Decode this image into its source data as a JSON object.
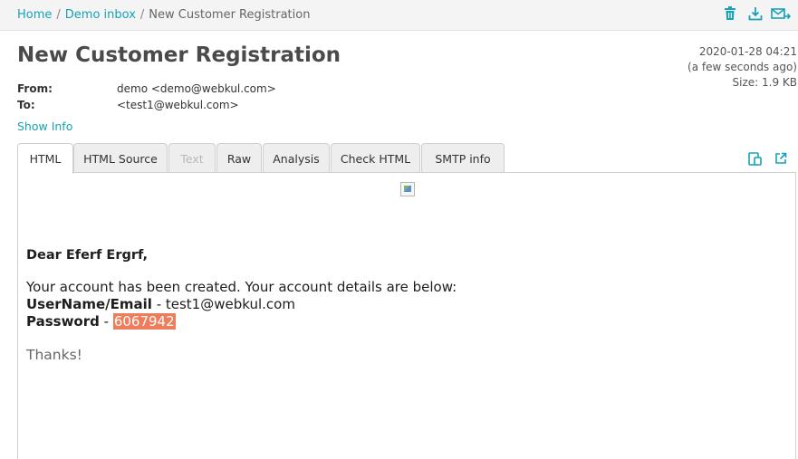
{
  "breadcrumb": {
    "home": "Home",
    "inbox": "Demo inbox",
    "current": "New Customer Registration",
    "separator": "/"
  },
  "toolbar_icons": [
    "trash-icon",
    "download-icon",
    "forward-icon"
  ],
  "message": {
    "subject": "New Customer Registration",
    "date": "2020-01-28 04:21",
    "relative_time": "(a few seconds ago)",
    "size": "Size: 1.9 KB",
    "from_label": "From:",
    "from_value": "demo <demo@webkul.com>",
    "to_label": "To:",
    "to_value": "<test1@webkul.com>",
    "show_info": "Show Info"
  },
  "tabs": [
    {
      "label": "HTML",
      "state": "active"
    },
    {
      "label": "HTML Source",
      "state": "normal"
    },
    {
      "label": "Text",
      "state": "disabled"
    },
    {
      "label": "Raw",
      "state": "normal"
    },
    {
      "label": "Analysis",
      "state": "normal"
    },
    {
      "label": "Check HTML",
      "state": "normal"
    },
    {
      "label": "SMTP info",
      "state": "normal"
    }
  ],
  "view_icons": [
    "mobile-view-icon",
    "open-external-icon"
  ],
  "email_body": {
    "greeting": "Dear Eferf Ergrf,",
    "intro": "Your account has been created. Your account details are below:",
    "username_label": "UserName/Email",
    "username_sep": " - ",
    "username_value": "test1@webkul.com",
    "password_label": "Password",
    "password_sep": " - ",
    "password_value": "6067942",
    "thanks": "Thanks!"
  },
  "colors": {
    "accent": "#17a2b8",
    "highlight": "#ef7d5b"
  }
}
